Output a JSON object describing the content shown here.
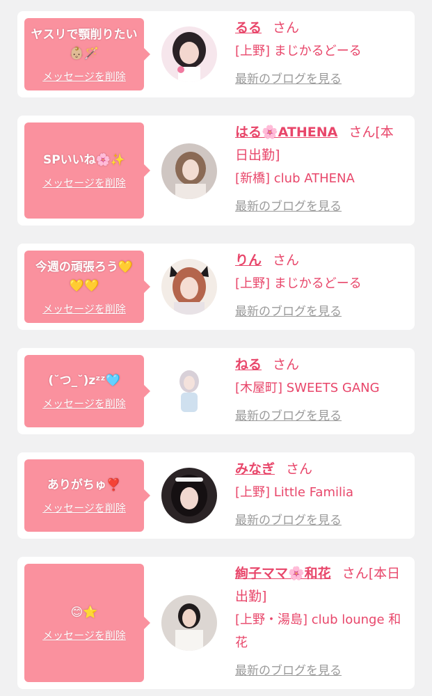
{
  "common": {
    "delete_label": "メッセージを削除",
    "honorific": "さん",
    "blog_label": "最新のブログを見る"
  },
  "cards": [
    {
      "message": "ヤスリで顎削りたい👶🏼🪄",
      "name": "るる",
      "suffix": "",
      "shop": "[上野] まじかるどーる"
    },
    {
      "message": "SPいいね🌸✨",
      "name": "はる🌸ATHENA",
      "suffix": "[本日出勤]",
      "shop": "[新橋] club ATHENA"
    },
    {
      "message": "今週の頑張ろう💛💛💛",
      "name": "りん",
      "suffix": "",
      "shop": "[上野] まじかるどーる"
    },
    {
      "message": "(˘つ_˘)zᶻᶻ🩵",
      "name": "ねる",
      "suffix": "",
      "shop": "[木屋町] SWEETS GANG"
    },
    {
      "message": "ありがちゅ❣️",
      "name": "みなぎ",
      "suffix": "",
      "shop": "[上野] Little Familia"
    },
    {
      "message": "😊⭐",
      "name": "絢子ママ🌸和花",
      "suffix": "[本日出勤]",
      "shop": "[上野・湯島] club lounge 和花"
    }
  ],
  "colors": {
    "bubble": "#fa919e",
    "accent": "#e8466a",
    "muted": "#9a9a9a",
    "background": "#f1f1f2"
  }
}
